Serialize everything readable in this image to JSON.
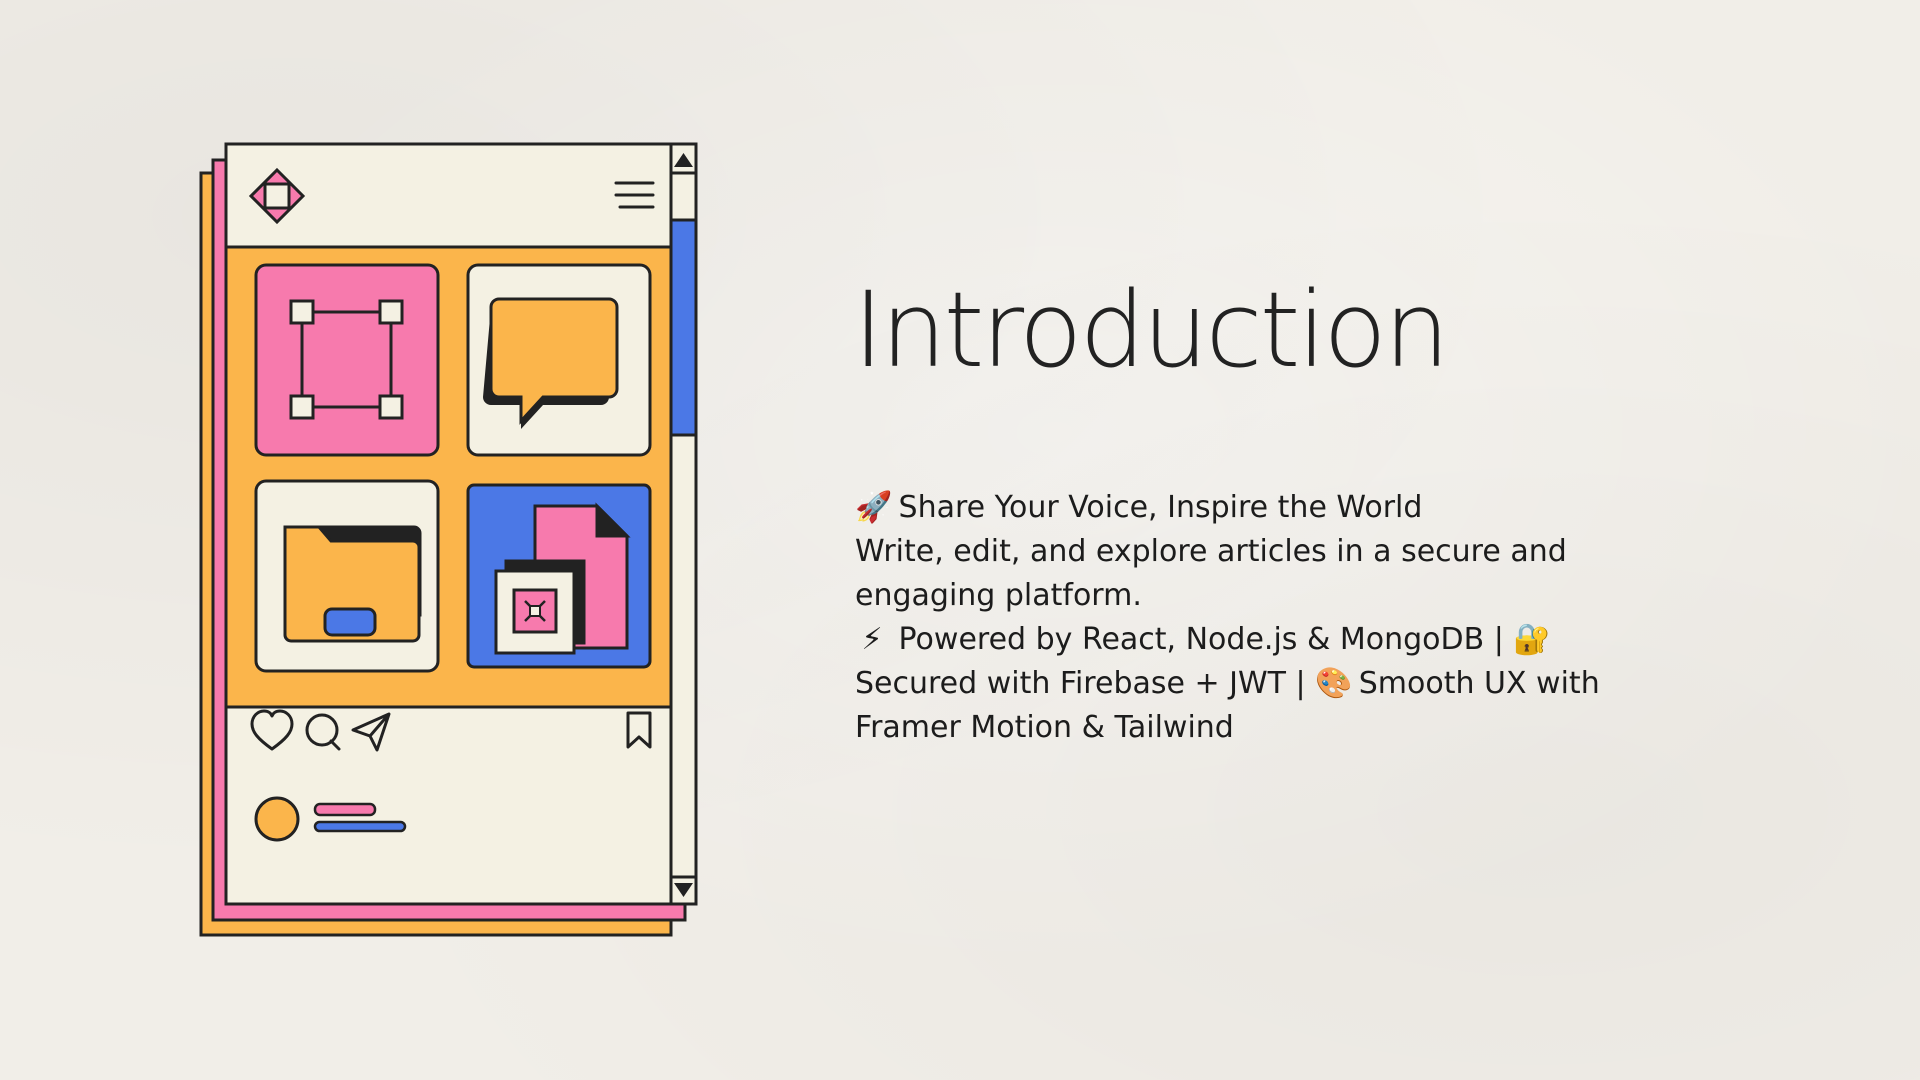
{
  "slide": {
    "title": "Introduction",
    "lines": [
      {
        "icon": "rocket-icon",
        "glyph": "🚀",
        "text": " Share Your Voice, Inspire the World"
      },
      {
        "text": " Write, edit, and explore articles in a secure and"
      },
      {
        "text": "engaging platform."
      },
      {
        "icon": "lightning-icon",
        "glyph": "⚡",
        "text": " Powered by React, Node.js & MongoDB | ",
        "icon2": "lock-key-icon",
        "glyph2": "🔐"
      },
      {
        "text": "Secured with Firebase + JWT | ",
        "icon": "palette-icon",
        "glyph": "🎨",
        "text2": " Smooth UX with"
      },
      {
        "text": "Framer Motion & Tailwind"
      }
    ]
  },
  "illustration": {
    "icons": [
      "diamond-logo-icon",
      "hamburger-menu-icon",
      "selection-frame-icon",
      "speech-bubble-icon",
      "folder-icon",
      "documents-icon",
      "heart-icon",
      "comment-icon",
      "send-icon",
      "bookmark-icon",
      "avatar-circle"
    ],
    "scroll_position": 0.3
  },
  "colors": {
    "background": "#f1eee8",
    "orange": "#fbb54b",
    "pink": "#f77aad",
    "blue": "#4b78e6",
    "cream": "#f4f1e3",
    "ink": "#222222"
  }
}
